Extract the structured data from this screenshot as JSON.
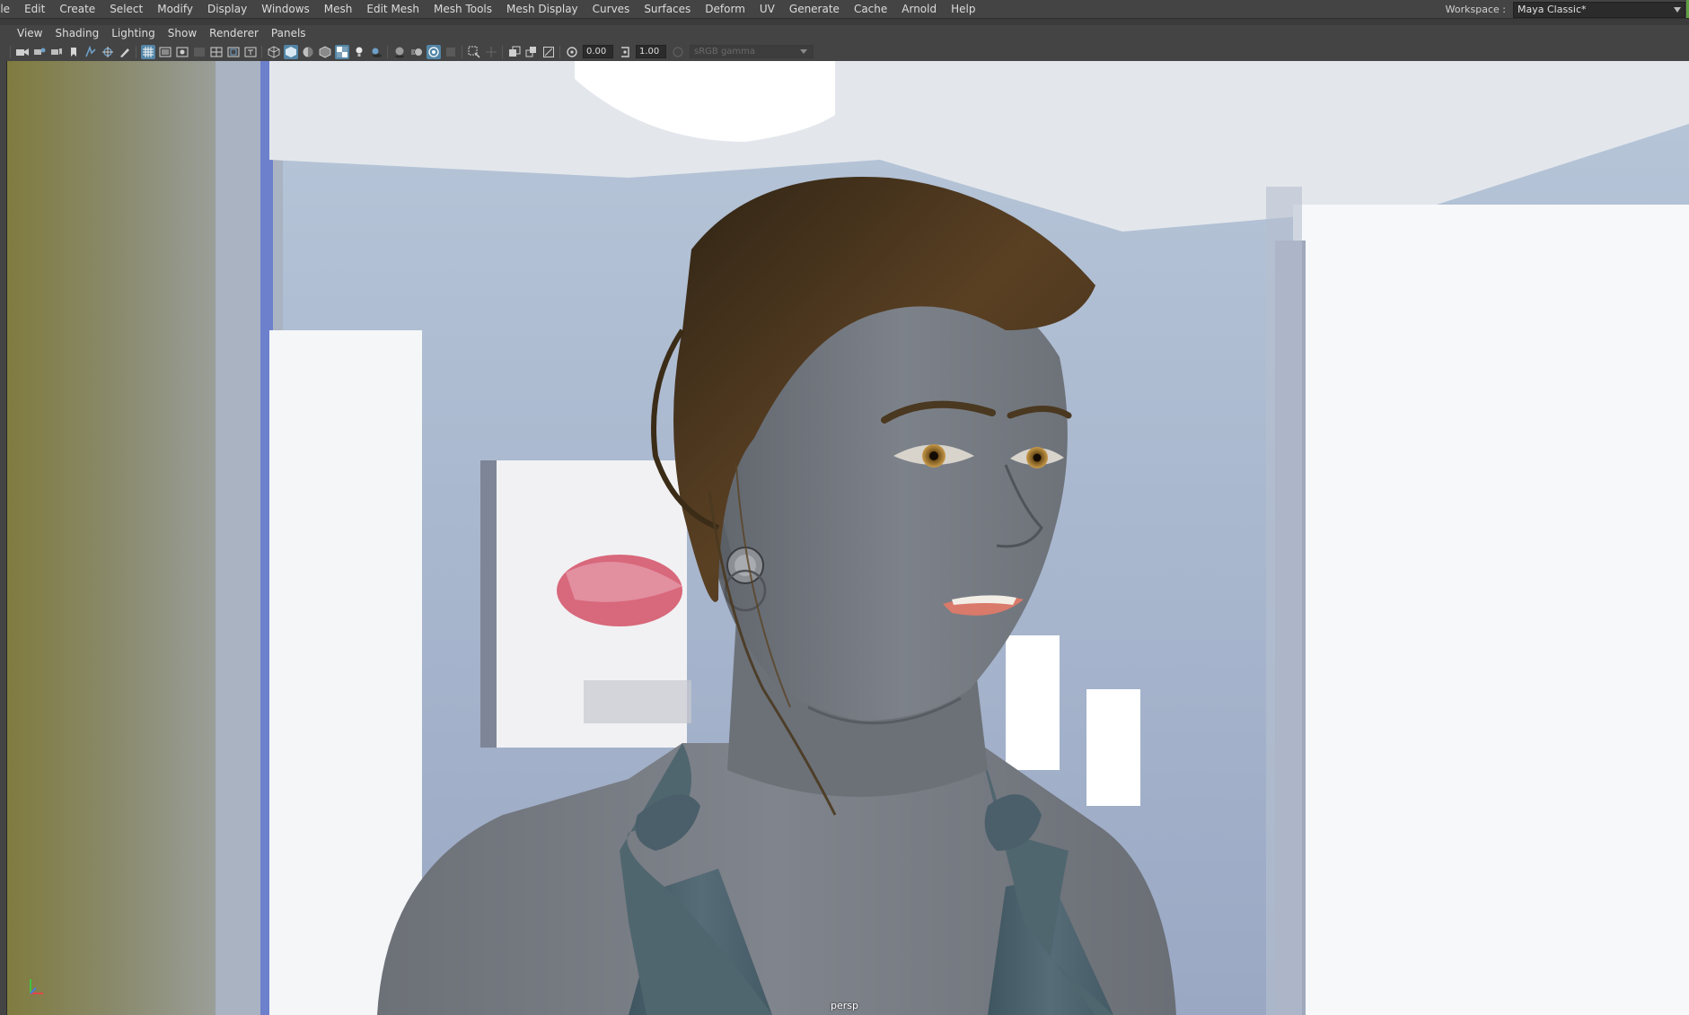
{
  "menubar": {
    "items": [
      "ile",
      "Edit",
      "Create",
      "Select",
      "Modify",
      "Display",
      "Windows",
      "Mesh",
      "Edit Mesh",
      "Mesh Tools",
      "Mesh Display",
      "Curves",
      "Surfaces",
      "Deform",
      "UV",
      "Generate",
      "Cache",
      "Arnold",
      "Help"
    ]
  },
  "workspace": {
    "label": "Workspace :",
    "value": "Maya Classic*"
  },
  "panel_menu": {
    "items": [
      "View",
      "Shading",
      "Lighting",
      "Show",
      "Renderer",
      "Panels"
    ]
  },
  "toolbar": {
    "exposure_value": "0.00",
    "gamma_value": "1.00",
    "color_space": "sRGB gamma"
  },
  "viewport": {
    "camera_label": "persp"
  },
  "colors": {
    "accent_blue": "#5285a6",
    "menu_background": "#444444",
    "workspace_accent": "#5fa043"
  }
}
